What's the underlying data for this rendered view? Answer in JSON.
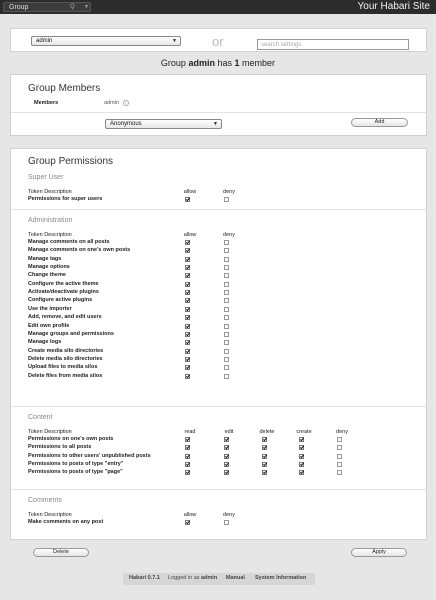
{
  "topbar": {
    "menu_label": "Group",
    "menu_shortcut": "Q",
    "site_title": "Your Habari Site"
  },
  "selector": {
    "group_value": "admin",
    "or_text": "or",
    "search_placeholder": "search settings"
  },
  "summary": {
    "prefix": "Group",
    "group": "admin",
    "middle": "has",
    "count": "1",
    "suffix": "member"
  },
  "members": {
    "title": "Group Members",
    "members_label": "Members",
    "member_name": "admin",
    "add_select_value": "Anonymous",
    "add_button": "Add"
  },
  "permissions": {
    "title": "Group Permissions",
    "sections": [
      {
        "title": "Super User",
        "header": [
          "Token Description",
          "allow",
          "deny"
        ],
        "rows": [
          {
            "label": "Permissions for super users",
            "checks": [
              true,
              false
            ]
          }
        ]
      },
      {
        "title": "Administration",
        "header": [
          "Token Description",
          "allow",
          "deny"
        ],
        "rows": [
          {
            "label": "Manage comments on all posts",
            "checks": [
              true,
              false
            ]
          },
          {
            "label": "Manage comments on one's own posts",
            "checks": [
              true,
              false
            ]
          },
          {
            "label": "Manage tags",
            "checks": [
              true,
              false
            ]
          },
          {
            "label": "Manage options",
            "checks": [
              true,
              false
            ]
          },
          {
            "label": "Change theme",
            "checks": [
              true,
              false
            ]
          },
          {
            "label": "Configure the active theme",
            "checks": [
              true,
              false
            ]
          },
          {
            "label": "Activate/deactivate plugins",
            "checks": [
              true,
              false
            ]
          },
          {
            "label": "Configure active plugins",
            "checks": [
              true,
              false
            ]
          },
          {
            "label": "Use the importer",
            "checks": [
              true,
              false
            ]
          },
          {
            "label": "Add, remove, and edit users",
            "checks": [
              true,
              false
            ]
          },
          {
            "label": "Edit own profile",
            "checks": [
              true,
              false
            ]
          },
          {
            "label": "Manage groups and permissions",
            "checks": [
              true,
              false
            ]
          },
          {
            "label": "Manage logs",
            "checks": [
              true,
              false
            ]
          },
          {
            "label": "Create media silo directories",
            "checks": [
              true,
              false
            ]
          },
          {
            "label": "Delete media silo directories",
            "checks": [
              true,
              false
            ]
          },
          {
            "label": "Upload files to media silos",
            "checks": [
              true,
              false
            ]
          },
          {
            "label": "Delete files from media silos",
            "checks": [
              true,
              false
            ]
          }
        ]
      },
      {
        "title": "Content",
        "header": [
          "Token Description",
          "read",
          "edit",
          "delete",
          "create",
          "deny"
        ],
        "rows": [
          {
            "label": "Permissions on one's own posts",
            "checks": [
              true,
              true,
              true,
              true,
              false
            ]
          },
          {
            "label": "Permissions to all posts",
            "checks": [
              true,
              true,
              true,
              true,
              false
            ]
          },
          {
            "label": "Permissions to other users' unpublished posts",
            "checks": [
              true,
              true,
              true,
              true,
              false
            ]
          },
          {
            "label": "Permissions to posts of type \"entry\"",
            "checks": [
              true,
              true,
              true,
              true,
              false
            ]
          },
          {
            "label": "Permissions to posts of type \"page\"",
            "checks": [
              true,
              true,
              true,
              true,
              false
            ]
          }
        ]
      },
      {
        "title": "Comments",
        "header": [
          "Token Description",
          "allow",
          "deny"
        ],
        "rows": [
          {
            "label": "Make comments on any post",
            "checks": [
              true,
              false
            ]
          }
        ]
      }
    ]
  },
  "actions": {
    "delete_button": "Delete",
    "apply_button": "Apply"
  },
  "footer": {
    "version": "Habari 0.7.1",
    "logged_in_as": "Logged in as",
    "user": "admin",
    "manual": "Manual",
    "system_info": "System Information"
  }
}
